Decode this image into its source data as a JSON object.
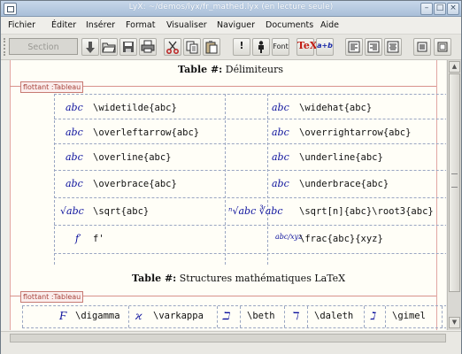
{
  "window": {
    "title": "LyX: ~/demos/lyx/fr_mathed.lyx (en lecture seule)",
    "minimize_glyph": "–",
    "maximize_glyph": "□",
    "close_glyph": "×"
  },
  "menubar": {
    "items": [
      "Fichier",
      "Éditer",
      "Insérer",
      "Format",
      "Visualiser",
      "Naviguer",
      "Documents",
      "Aide"
    ]
  },
  "toolbar": {
    "layout_value": "Section",
    "tools": [
      {
        "icon": "down-arrow-icon"
      },
      {
        "icon": "open-folder-icon"
      },
      {
        "icon": "save-icon"
      },
      {
        "icon": "print-icon"
      },
      {
        "icon": "cut-icon"
      },
      {
        "icon": "copy-icon"
      },
      {
        "icon": "paste-icon"
      },
      {
        "icon": "emphasis-icon",
        "glyph": "!"
      },
      {
        "icon": "noun-icon"
      },
      {
        "icon": "font-icon",
        "glyph": "Font"
      },
      {
        "icon": "tex-icon",
        "glyph": "TeX"
      },
      {
        "icon": "math-icon",
        "glyph": "a+b"
      },
      {
        "icon": "align-left-icon"
      },
      {
        "icon": "align-right-icon"
      },
      {
        "icon": "align-center-icon"
      },
      {
        "icon": "table-icon"
      },
      {
        "icon": "figure-icon"
      }
    ]
  },
  "document": {
    "caption1_prefix": "Table #:",
    "caption1_text": "Délimiteurs",
    "float_label": "flottant :Tableau",
    "rows": [
      {
        "sym_left": "abc",
        "cmd_left": "\\widetilde{abc}",
        "sym_right": "abc",
        "cmd_right": "\\widehat{abc}"
      },
      {
        "sym_left": "abc",
        "cmd_left": "\\overleftarrow{abc}",
        "sym_right": "abc",
        "cmd_right": "\\overrightarrow{abc}"
      },
      {
        "sym_left": "abc",
        "cmd_left": "\\overline{abc}",
        "sym_right": "abc",
        "cmd_right": "\\underline{abc}"
      },
      {
        "sym_left": "abc",
        "cmd_left": "\\overbrace{abc}",
        "sym_right": "abc",
        "cmd_right": "\\underbrace{abc}"
      },
      {
        "sym_left": "√abc",
        "cmd_left": "\\sqrt{abc}",
        "sym_right": "ⁿ√abc ∛abc",
        "cmd_right": "\\sqrt[n]{abc}\\root3{abc}"
      },
      {
        "sym_left": "f′",
        "cmd_left": "f'",
        "sym_right": "abc/xyz",
        "cmd_right": "\\frac{abc}{xyz}"
      }
    ],
    "caption2_prefix": "Table #:",
    "caption2_text": "Structures mathématiques LaTeX",
    "float_label2": "flottant :Tableau",
    "row2": [
      {
        "sym": "Ϝ",
        "cmd": "\\digamma"
      },
      {
        "sym": "ϰ",
        "cmd": "\\varkappa"
      },
      {
        "sym": "ℶ",
        "cmd": "\\beth"
      },
      {
        "sym": "ℸ",
        "cmd": "\\daleth"
      },
      {
        "sym": "ℷ",
        "cmd": "\\gimel"
      }
    ]
  }
}
